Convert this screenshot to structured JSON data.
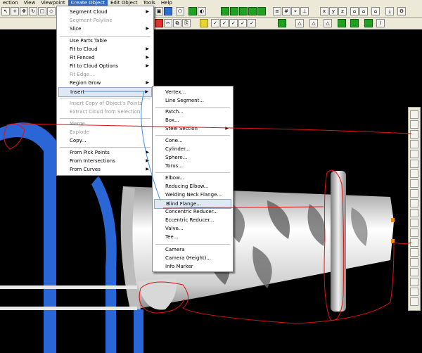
{
  "menubar": {
    "items": [
      "ection",
      "View",
      "Viewpoint",
      "Create Object",
      "Edit Object",
      "Tools",
      "Help"
    ],
    "active_index": 3
  },
  "create_object_menu": {
    "items": [
      {
        "label": "Segment Cloud",
        "submenu": true,
        "disabled": false
      },
      {
        "label": "Segment Polyline",
        "submenu": false,
        "disabled": true
      },
      {
        "label": "Slice",
        "submenu": true,
        "disabled": false
      },
      {
        "label": "Use Parts Table",
        "submenu": false,
        "disabled": false
      },
      {
        "label": "Fit to Cloud",
        "submenu": true,
        "disabled": false
      },
      {
        "label": "Fit Fenced",
        "submenu": true,
        "disabled": false
      },
      {
        "label": "Fit to Cloud Options",
        "submenu": true,
        "disabled": false
      },
      {
        "label": "Fit Edge...",
        "submenu": false,
        "disabled": true
      },
      {
        "label": "Region Grow",
        "submenu": true,
        "disabled": false
      },
      {
        "label": "Insert",
        "submenu": true,
        "disabled": false,
        "highlight": true
      },
      {
        "label": "Insert Copy of Object's Points",
        "submenu": false,
        "disabled": true
      },
      {
        "label": "Extract Cloud from Selection",
        "submenu": false,
        "disabled": true
      },
      {
        "label": "Merge",
        "submenu": false,
        "disabled": true
      },
      {
        "label": "Explode",
        "submenu": false,
        "disabled": true
      },
      {
        "label": "Copy...",
        "submenu": false,
        "disabled": false
      },
      {
        "label": "From Pick Points",
        "submenu": true,
        "disabled": false
      },
      {
        "label": "From Intersections",
        "submenu": true,
        "disabled": false
      },
      {
        "label": "From Curves",
        "submenu": true,
        "disabled": false
      }
    ]
  },
  "insert_submenu": {
    "items": [
      {
        "label": "Vertex...",
        "submenu": false
      },
      {
        "label": "Line Segment...",
        "submenu": false
      },
      {
        "label": "Patch...",
        "submenu": false
      },
      {
        "label": "Box...",
        "submenu": false
      },
      {
        "label": "Steel Section",
        "submenu": true
      },
      {
        "label": "Cone...",
        "submenu": false
      },
      {
        "label": "Cylinder...",
        "submenu": false
      },
      {
        "label": "Sphere...",
        "submenu": false
      },
      {
        "label": "Torus...",
        "submenu": false
      },
      {
        "label": "Elbow...",
        "submenu": false
      },
      {
        "label": "Reducing Elbow...",
        "submenu": false
      },
      {
        "label": "Welding Neck Flange...",
        "submenu": false
      },
      {
        "label": "Blind Flange...",
        "submenu": false,
        "highlight": true
      },
      {
        "label": "Concentric Reducer...",
        "submenu": false
      },
      {
        "label": "Eccentric Reducer...",
        "submenu": false
      },
      {
        "label": "Valve...",
        "submenu": false
      },
      {
        "label": "Tee...",
        "submenu": false
      },
      {
        "label": "Camera",
        "submenu": false
      },
      {
        "label": "Camera (Height)...",
        "submenu": false
      },
      {
        "label": "Info Marker",
        "submenu": false
      }
    ]
  },
  "colors": {
    "menu_highlight": "#e0e8f5",
    "menubar_active": "#316ac5",
    "annotation_red": "#e01010",
    "annotation_blue": "#3a8ee8",
    "pipe_blue": "#2a66d6"
  },
  "icons": [
    "pointer-icon",
    "zoom-icon",
    "pan-icon",
    "rotate-icon",
    "select-icon",
    "fence-icon",
    "grid-icon",
    "layers-icon",
    "settings-icon"
  ]
}
